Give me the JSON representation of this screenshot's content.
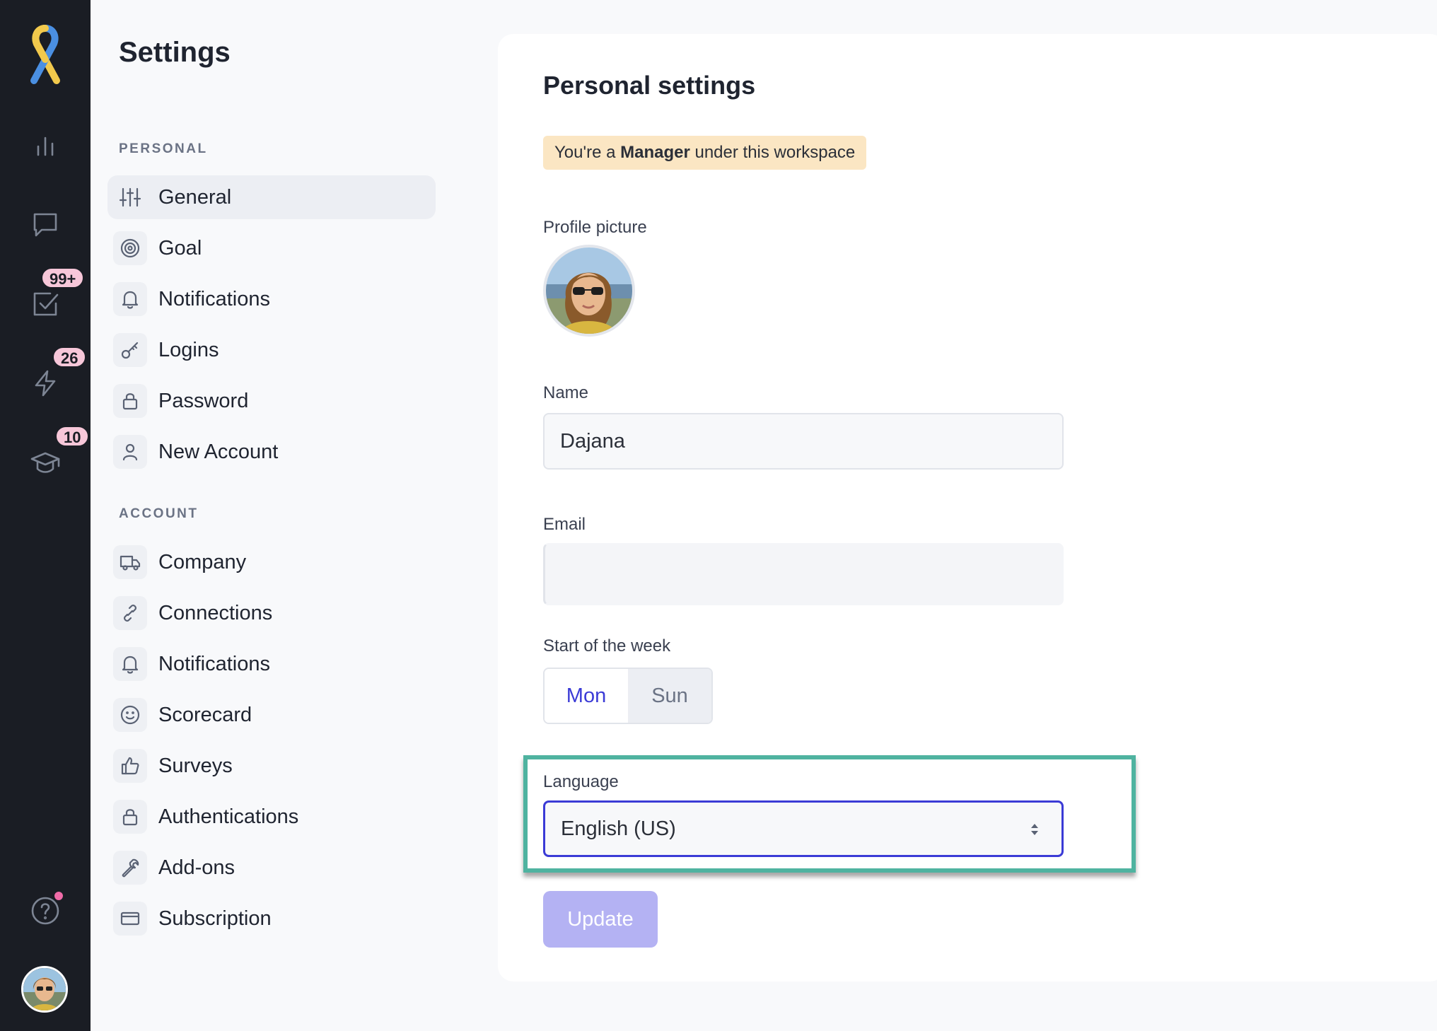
{
  "rail": {
    "badges": {
      "tasks": "99+",
      "activity": "26",
      "learning": "10"
    }
  },
  "page": {
    "title": "Settings"
  },
  "sidebar": {
    "personal_label": "PERSONAL",
    "personal_items": [
      {
        "label": "General",
        "icon": "sliders-icon"
      },
      {
        "label": "Goal",
        "icon": "target-icon"
      },
      {
        "label": "Notifications",
        "icon": "bell-icon"
      },
      {
        "label": "Logins",
        "icon": "key-icon"
      },
      {
        "label": "Password",
        "icon": "lock-icon"
      },
      {
        "label": "New Account",
        "icon": "user-icon"
      }
    ],
    "account_label": "ACCOUNT",
    "account_items": [
      {
        "label": "Company",
        "icon": "truck-icon"
      },
      {
        "label": "Connections",
        "icon": "link-icon"
      },
      {
        "label": "Notifications",
        "icon": "bell-icon"
      },
      {
        "label": "Scorecard",
        "icon": "smile-icon"
      },
      {
        "label": "Surveys",
        "icon": "thumbs-up-icon"
      },
      {
        "label": "Authentications",
        "icon": "lock-icon"
      },
      {
        "label": "Add-ons",
        "icon": "wrench-icon"
      },
      {
        "label": "Subscription",
        "icon": "credit-card-icon"
      }
    ]
  },
  "main": {
    "title": "Personal settings",
    "role_prefix": "You're a ",
    "role_name": "Manager",
    "role_suffix": " under this workspace",
    "profile_picture_label": "Profile picture",
    "name_label": "Name",
    "name_value": "Dajana",
    "email_label": "Email",
    "email_value": "",
    "week_label": "Start of the week",
    "week_options": [
      "Mon",
      "Sun"
    ],
    "week_selected": "Mon",
    "language_label": "Language",
    "language_value": "English (US)",
    "update_label": "Update"
  },
  "colors": {
    "accent": "#3b3bd6",
    "highlight": "#4fb3a0",
    "banner": "#fbe6c3",
    "badge": "#f7c7d9",
    "update_disabled": "#b4b2f3"
  }
}
